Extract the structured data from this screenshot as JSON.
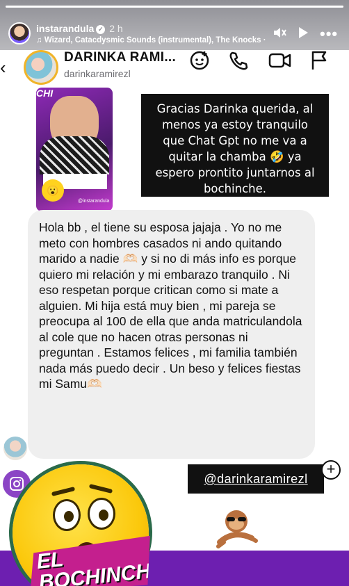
{
  "story": {
    "username": "instarandula",
    "time": "2 h",
    "music": "Wizard, Catacdysmic Sounds (instrumental), The Knocks · I",
    "progress_fraction": 1.0
  },
  "dm": {
    "name": "DARINKA RAMI...",
    "handle": "darinkaramirezl"
  },
  "post": {
    "corner_text": "CHI",
    "tag": "@instarandula",
    "badge_text": "EL BOCHINCHE"
  },
  "caption": "Gracias Darinka querida, al menos ya estoy tranquilo que Chat Gpt no me va a quitar la chamba 🤣 ya espero prontito juntarnos al bochinche.",
  "message": "Hola bb , el tiene su esposa jajaja . Yo no me meto con hombres casados ni ando quitando marido a nadie 🫶🏻 y si no di más info es porque quiero mi relación y mi embarazo tranquilo . Ni eso respetan porque critican como si mate a alguien. Mi hija está muy bien , mi pareja se preocupa al 100 de ella que anda matriculandola al cole que no hacen otras personas ni preguntan . Estamos felices , mi familia también nada más puedo decir . Un beso y felices fiestas mi Samu🫶🏻",
  "mention": "@darinkaramirezl",
  "sticker_brand": "EL BOCHINCHE",
  "colors": {
    "purple": "#6d1fb0",
    "caption_bg": "#111111",
    "bubble_bg": "#efefef",
    "emoji_yellow": "#fbc80b"
  }
}
